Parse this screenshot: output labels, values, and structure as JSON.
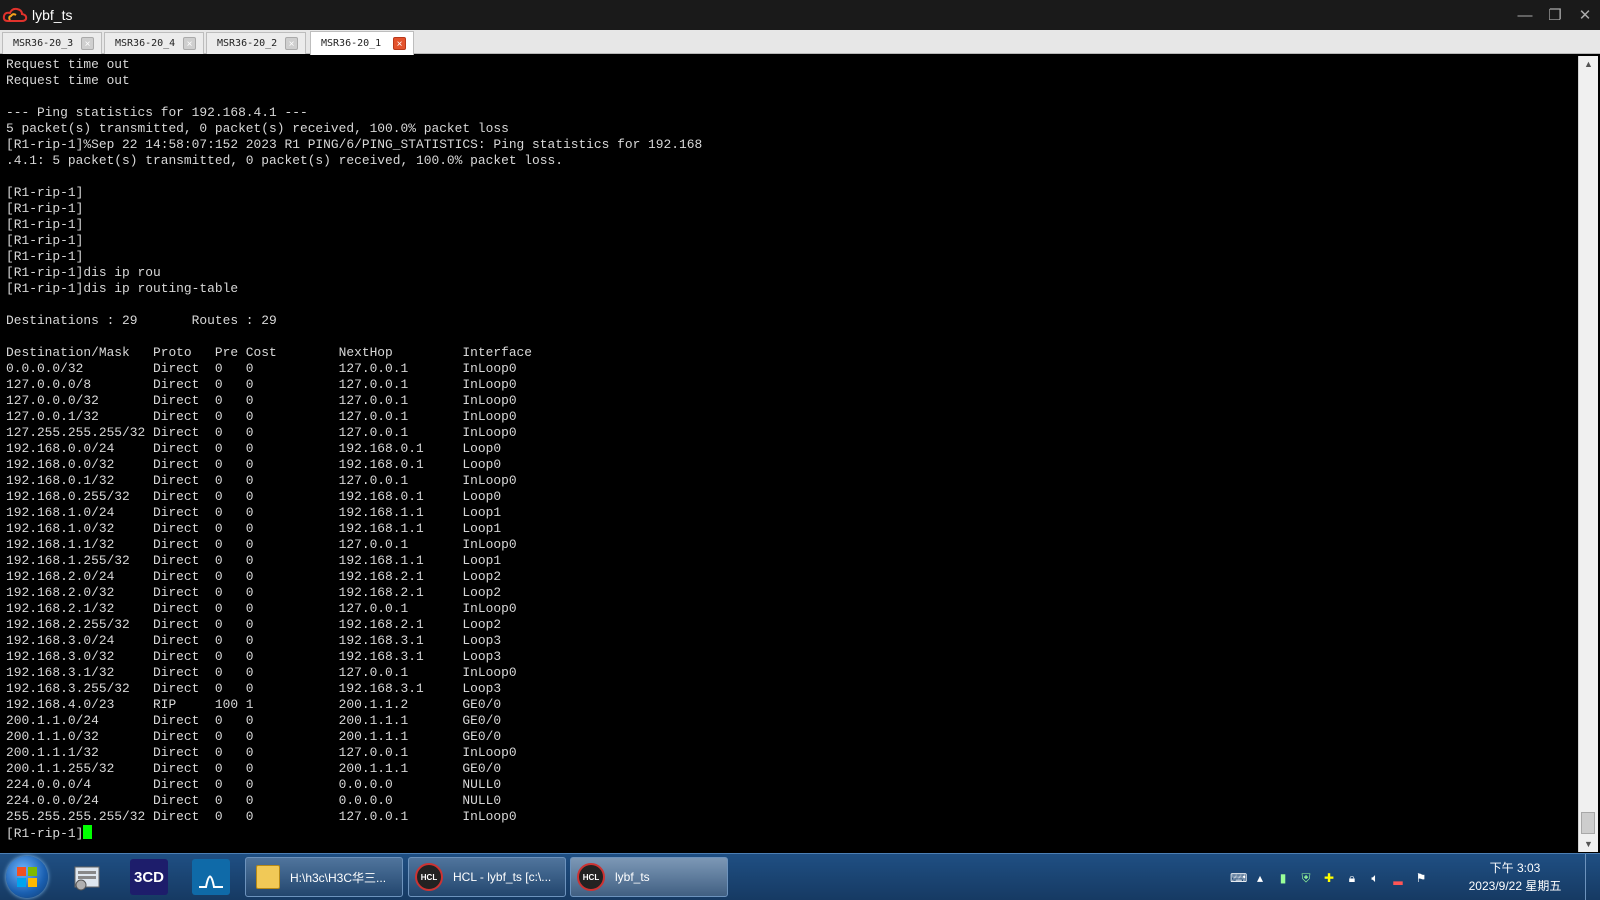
{
  "window": {
    "title": "lybf_ts",
    "minimize": "—",
    "restore": "❐",
    "close": "✕"
  },
  "tabs": [
    {
      "label": "MSR36-20_3",
      "close": "×"
    },
    {
      "label": "MSR36-20_4",
      "close": "×"
    },
    {
      "label": "MSR36-20_2",
      "close": "×"
    },
    {
      "label": "MSR36-20_1",
      "close": "×"
    }
  ],
  "terminal": {
    "lines": [
      "Request time out",
      "Request time out",
      "",
      "--- Ping statistics for 192.168.4.1 ---",
      "5 packet(s) transmitted, 0 packet(s) received, 100.0% packet loss",
      "[R1-rip-1]%Sep 22 14:58:07:152 2023 R1 PING/6/PING_STATISTICS: Ping statistics for 192.168",
      ".4.1: 5 packet(s) transmitted, 0 packet(s) received, 100.0% packet loss.",
      "",
      "[R1-rip-1]",
      "[R1-rip-1]",
      "[R1-rip-1]",
      "[R1-rip-1]",
      "[R1-rip-1]",
      "[R1-rip-1]dis ip rou",
      "[R1-rip-1]dis ip routing-table",
      "",
      "Destinations : 29       Routes : 29",
      "",
      "Destination/Mask   Proto   Pre Cost        NextHop         Interface",
      "0.0.0.0/32         Direct  0   0           127.0.0.1       InLoop0",
      "127.0.0.0/8        Direct  0   0           127.0.0.1       InLoop0",
      "127.0.0.0/32       Direct  0   0           127.0.0.1       InLoop0",
      "127.0.0.1/32       Direct  0   0           127.0.0.1       InLoop0",
      "127.255.255.255/32 Direct  0   0           127.0.0.1       InLoop0",
      "192.168.0.0/24     Direct  0   0           192.168.0.1     Loop0",
      "192.168.0.0/32     Direct  0   0           192.168.0.1     Loop0",
      "192.168.0.1/32     Direct  0   0           127.0.0.1       InLoop0",
      "192.168.0.255/32   Direct  0   0           192.168.0.1     Loop0",
      "192.168.1.0/24     Direct  0   0           192.168.1.1     Loop1",
      "192.168.1.0/32     Direct  0   0           192.168.1.1     Loop1",
      "192.168.1.1/32     Direct  0   0           127.0.0.1       InLoop0",
      "192.168.1.255/32   Direct  0   0           192.168.1.1     Loop1",
      "192.168.2.0/24     Direct  0   0           192.168.2.1     Loop2",
      "192.168.2.0/32     Direct  0   0           192.168.2.1     Loop2",
      "192.168.2.1/32     Direct  0   0           127.0.0.1       InLoop0",
      "192.168.2.255/32   Direct  0   0           192.168.2.1     Loop2",
      "192.168.3.0/24     Direct  0   0           192.168.3.1     Loop3",
      "192.168.3.0/32     Direct  0   0           192.168.3.1     Loop3",
      "192.168.3.1/32     Direct  0   0           127.0.0.1       InLoop0",
      "192.168.3.255/32   Direct  0   0           192.168.3.1     Loop3",
      "192.168.4.0/23     RIP     100 1           200.1.1.2       GE0/0",
      "200.1.1.0/24       Direct  0   0           200.1.1.1       GE0/0",
      "200.1.1.0/32       Direct  0   0           200.1.1.1       GE0/0",
      "200.1.1.1/32       Direct  0   0           127.0.0.1       InLoop0",
      "200.1.1.255/32     Direct  0   0           200.1.1.1       GE0/0",
      "224.0.0.0/4        Direct  0   0           0.0.0.0         NULL0",
      "224.0.0.0/24       Direct  0   0           0.0.0.0         NULL0",
      "255.255.255.255/32 Direct  0   0           127.0.0.1       InLoop0"
    ],
    "prompt": "[R1-rip-1]",
    "cursor_color": "#00ff00"
  },
  "taskbar": {
    "quick_launch": [
      {
        "icon": "explorer-icon"
      },
      {
        "icon": "3cd-icon",
        "label": "3CD"
      },
      {
        "icon": "network-monitor-icon"
      }
    ],
    "buttons": [
      {
        "label": "H:\\h3c\\H3C华三...",
        "icon": "folder-icon"
      },
      {
        "label": "HCL - lybf_ts [c:\\...",
        "icon": "hcl-icon"
      },
      {
        "label": "lybf_ts",
        "icon": "hcl-icon"
      }
    ],
    "hcl_badge": "HCL",
    "clock": {
      "time": "下午 3:03",
      "date": "2023/9/22 星期五"
    }
  }
}
